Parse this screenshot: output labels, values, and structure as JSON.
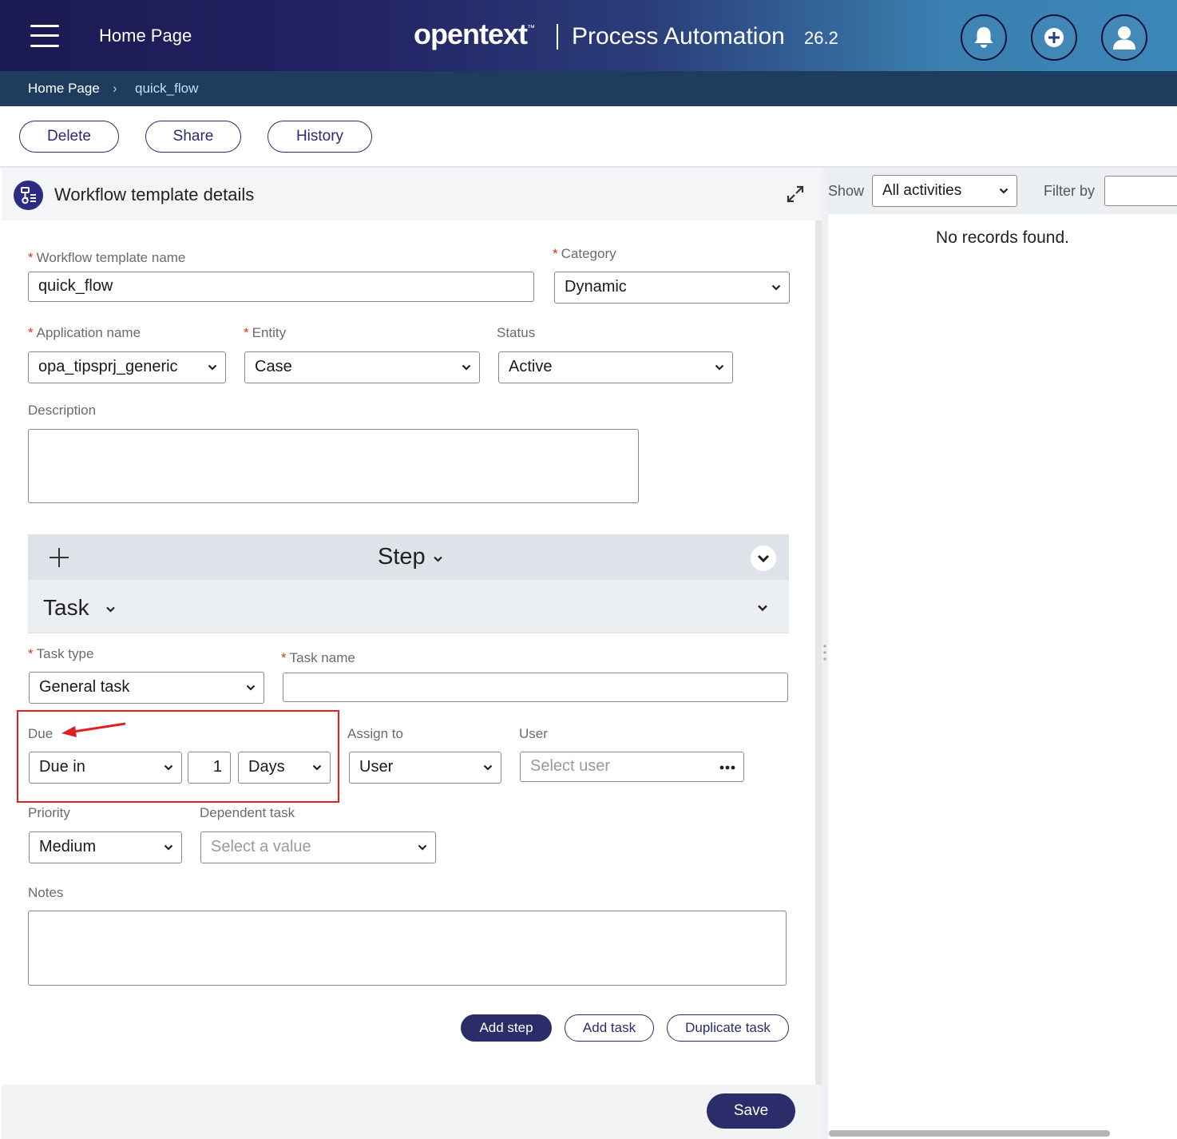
{
  "header": {
    "menu_icon": "hamburger-menu-icon",
    "home_title": "Home Page",
    "brand": "opentext",
    "brand_tm": "™",
    "product": "Process Automation",
    "version": "26.2",
    "actions": [
      {
        "name": "notifications",
        "icon": "bell-icon"
      },
      {
        "name": "create",
        "icon": "plus-circle-icon"
      },
      {
        "name": "user-profile",
        "icon": "user-icon"
      }
    ]
  },
  "breadcrumb": {
    "home": "Home Page",
    "separator": "›",
    "current": "quick_flow"
  },
  "toolbar": {
    "delete_label": "Delete",
    "share_label": "Share",
    "history_label": "History"
  },
  "panel": {
    "icon": "workflow-template-icon",
    "title": "Workflow template details",
    "expand_icon": "expand-arrows-icon"
  },
  "form": {
    "template_name": {
      "label": "Workflow template name",
      "value": "quick_flow",
      "required": true
    },
    "category": {
      "label": "Category",
      "value": "Dynamic",
      "required": true
    },
    "application_name": {
      "label": "Application name",
      "value": "opa_tipsprj_generic",
      "required": true
    },
    "entity": {
      "label": "Entity",
      "value": "Case",
      "required": true
    },
    "status": {
      "label": "Status",
      "value": "Active",
      "required": false
    },
    "description": {
      "label": "Description",
      "value": ""
    },
    "required_marker": "*"
  },
  "step_section": {
    "label": "Step",
    "task_label": "Task"
  },
  "task_form": {
    "task_type": {
      "label": "Task type",
      "value": "General task"
    },
    "task_name": {
      "label": "Task name",
      "value": ""
    },
    "due": {
      "label": "Due",
      "mode": "Due in",
      "amount": "1",
      "unit": "Days"
    },
    "assign_to": {
      "label": "Assign to",
      "value": "User"
    },
    "user": {
      "label": "User",
      "placeholder": "Select user",
      "more_icon": "ellipsis-icon"
    },
    "priority": {
      "label": "Priority",
      "value": "Medium"
    },
    "dependent_task": {
      "label": "Dependent task",
      "placeholder": "Select a value"
    },
    "notes": {
      "label": "Notes",
      "value": ""
    }
  },
  "actions": {
    "add_step": "Add step",
    "add_task": "Add task",
    "duplicate_task": "Duplicate task",
    "save": "Save"
  },
  "activity_panel": {
    "show_label": "Show",
    "show_value": "All activities",
    "filter_label": "Filter by",
    "filter_value": "",
    "empty_message": "No records found."
  },
  "colors": {
    "header_start": "#1b1a52",
    "header_end": "#3b87b8",
    "breadcrumb_bar": "#1d3c5e",
    "primary": "#2a2d6a",
    "required": "#e0301e",
    "highlight": "#e02020"
  }
}
